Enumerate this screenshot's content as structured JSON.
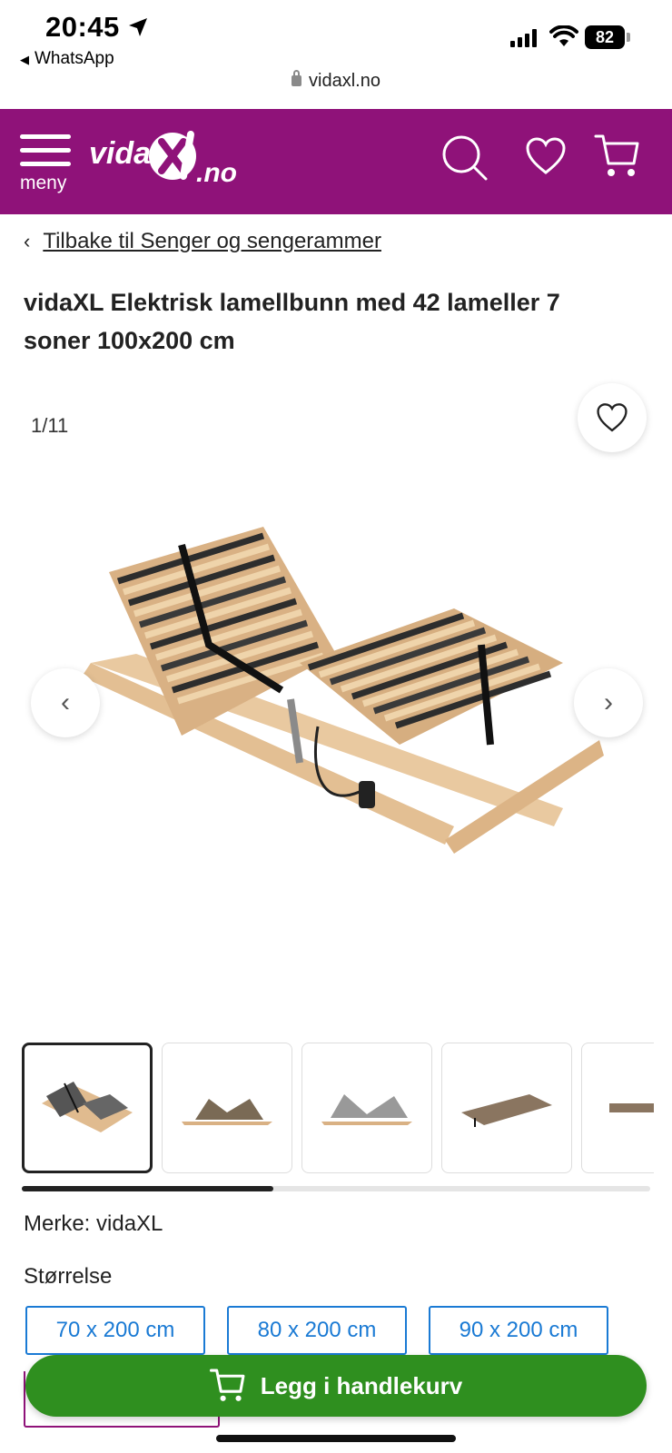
{
  "status_bar": {
    "time": "20:45",
    "back_app": "WhatsApp",
    "battery": "82",
    "url": "vidaxl.no"
  },
  "header": {
    "menu_label": "meny",
    "logo_text": "vidaXl.no",
    "brand_color": "#8f1279",
    "icons": [
      "search-icon",
      "heart-icon",
      "cart-icon"
    ]
  },
  "breadcrumb": {
    "chevron": "‹",
    "label": "Tilbake til Senger og sengerammer"
  },
  "product": {
    "title": "vidaXL Elektrisk lamellbunn med 42 lameller 7 soner 100x200 cm",
    "image_counter": "1/11",
    "brand_line": "Merke: vidaXL",
    "size_label": "Størrelse",
    "sizes": [
      "70 x 200 cm",
      "80 x 200 cm",
      "90 x 200 cm"
    ],
    "thumbnail_count_visible": 5,
    "gallery_scroll_fraction": 0.4
  },
  "cart": {
    "button_label": "Legg i handlekurv",
    "button_color": "#2f8f1f"
  }
}
